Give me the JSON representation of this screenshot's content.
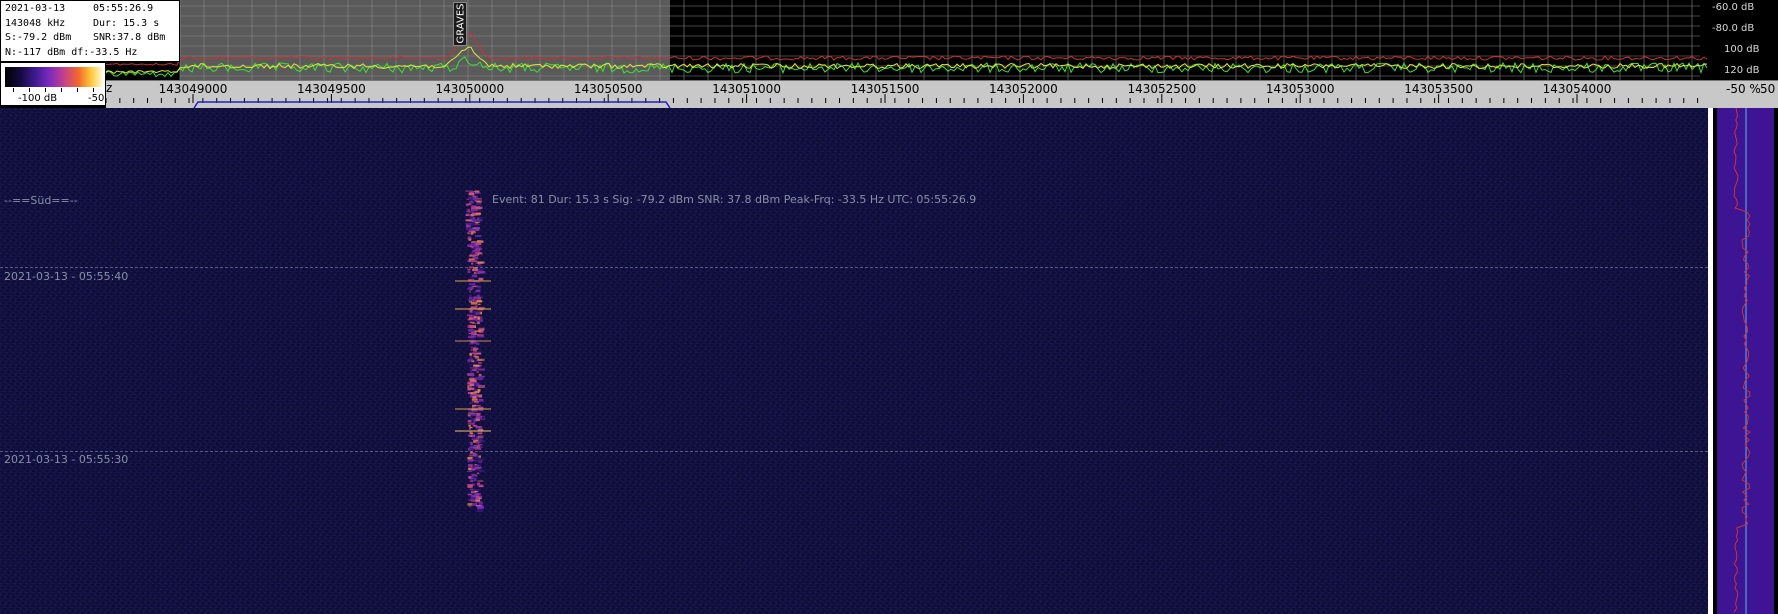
{
  "info": {
    "date": "2021-03-13",
    "time": "05:55:26.9",
    "freq": "143048 kHz",
    "dur": "Dur: 15.3 s",
    "signal": "S:-79.2 dBm",
    "snr": "SNR:37.8 dBm",
    "noise_df": "N:-117 dBm df:-33.5 Hz"
  },
  "color_scale": {
    "min_label": "-100 dB",
    "max_label": "-50"
  },
  "db_scale": {
    "labels": [
      "-60.0 dB",
      "-80.0 dB",
      "100 dB",
      "120 dB"
    ]
  },
  "freq_axis": {
    "prefix": "z",
    "labels": [
      "143049000",
      "143049500",
      "143050000",
      "143050500",
      "143051000",
      "143051500",
      "143052000",
      "143052500",
      "143053000",
      "143053500",
      "143054000"
    ]
  },
  "right_axis": {
    "labels": [
      "-50 %",
      "50"
    ]
  },
  "marker": {
    "label": "GRAVES"
  },
  "waterfall": {
    "station_label": "--==Süd==--",
    "event_text": "Event: 81   Dur: 15.3 s   Sig: -79.2 dBm   SNR: 37.8 dBm   Peak-Frq: -33.5 Hz   UTC: 05:55:26.9",
    "timestamps": [
      "2021-03-13 - 05:55:40",
      "2021-03-13 - 05:55:30"
    ]
  },
  "colors": {
    "waterfall_bg": "#0b0b2a",
    "spectrum_green": "#33e633",
    "spectrum_red": "#d03030",
    "spectrum_yellow": "#e6e633",
    "passband_gray": "#5a5a5a",
    "side_purple": "#3d1494"
  }
}
